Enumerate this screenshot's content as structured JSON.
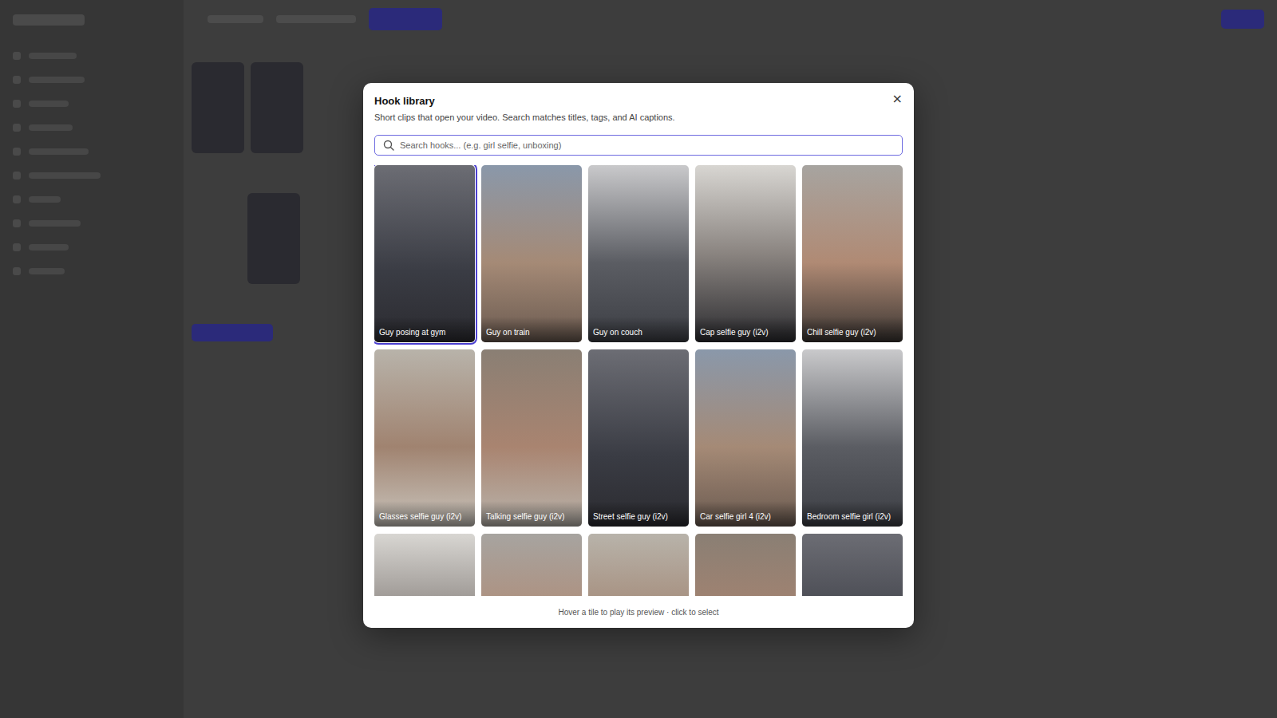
{
  "modal": {
    "title": "Hook library",
    "subtitle": "Short clips that open your video. Search matches titles, tags, and AI captions.",
    "close": "×",
    "search": {
      "placeholder": "Search hooks... (e.g. girl selfie, unboxing)"
    },
    "tiles": [
      {
        "label": "Guy posing at gym",
        "selected": true,
        "kind": "full"
      },
      {
        "label": "Guy on train",
        "selected": false,
        "kind": "full"
      },
      {
        "label": "Guy on couch",
        "selected": false,
        "kind": "full"
      },
      {
        "label": "Cap selfie guy (i2v)",
        "selected": false,
        "kind": "full"
      },
      {
        "label": "Chill selfie guy (i2v)",
        "selected": false,
        "kind": "full"
      },
      {
        "label": "Glasses selfie guy (i2v)",
        "selected": false,
        "kind": "full"
      },
      {
        "label": "Talking selfie guy (i2v)",
        "selected": false,
        "kind": "full"
      },
      {
        "label": "Street selfie guy (i2v)",
        "selected": false,
        "kind": "full"
      },
      {
        "label": "Car selfie girl 4 (i2v)",
        "selected": false,
        "kind": "full"
      },
      {
        "label": "Bedroom selfie girl (i2v)",
        "selected": false,
        "kind": "full"
      },
      {
        "label": "",
        "selected": false,
        "kind": "cut"
      },
      {
        "label": "",
        "selected": false,
        "kind": "cut"
      },
      {
        "label": "",
        "selected": false,
        "kind": "cut"
      },
      {
        "label": "",
        "selected": false,
        "kind": "cut"
      },
      {
        "label": "",
        "selected": false,
        "kind": "cut"
      }
    ],
    "footer": "Hover a tile to play its preview · click to select"
  }
}
